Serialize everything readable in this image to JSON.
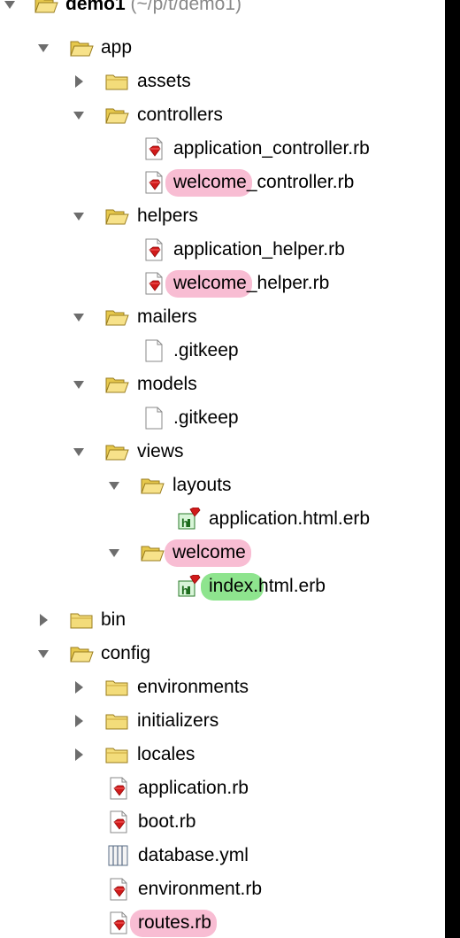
{
  "root": {
    "name": "demo1",
    "path": "(~/p/t/demo1)"
  },
  "colors": {
    "highlight_pink": "#f8bdd3",
    "highlight_green": "#8ee48e",
    "folder_yellow": "#f3dc7a",
    "ruby_red": "#d11a1a"
  },
  "tree": {
    "app": "app",
    "assets": "assets",
    "controllers": "controllers",
    "application_controller": "application_controller.rb",
    "welcome_controller_hl": "welcome",
    "welcome_controller_rest": "_controller.rb",
    "helpers": "helpers",
    "application_helper": "application_helper.rb",
    "welcome_helper_hl": "welcome",
    "welcome_helper_rest": "_helper.rb",
    "mailers": "mailers",
    "mailers_gitkeep": ".gitkeep",
    "models": "models",
    "models_gitkeep": ".gitkeep",
    "views": "views",
    "layouts": "layouts",
    "application_html_erb": "application.html.erb",
    "welcome_folder": "welcome",
    "index_hl": "index.",
    "index_rest": "html.erb",
    "bin": "bin",
    "config": "config",
    "environments": "environments",
    "initializers": "initializers",
    "locales": "locales",
    "application_rb": "application.rb",
    "boot_rb": "boot.rb",
    "database_yml": "database.yml",
    "environment_rb": "environment.rb",
    "routes_rb": "routes.rb"
  }
}
